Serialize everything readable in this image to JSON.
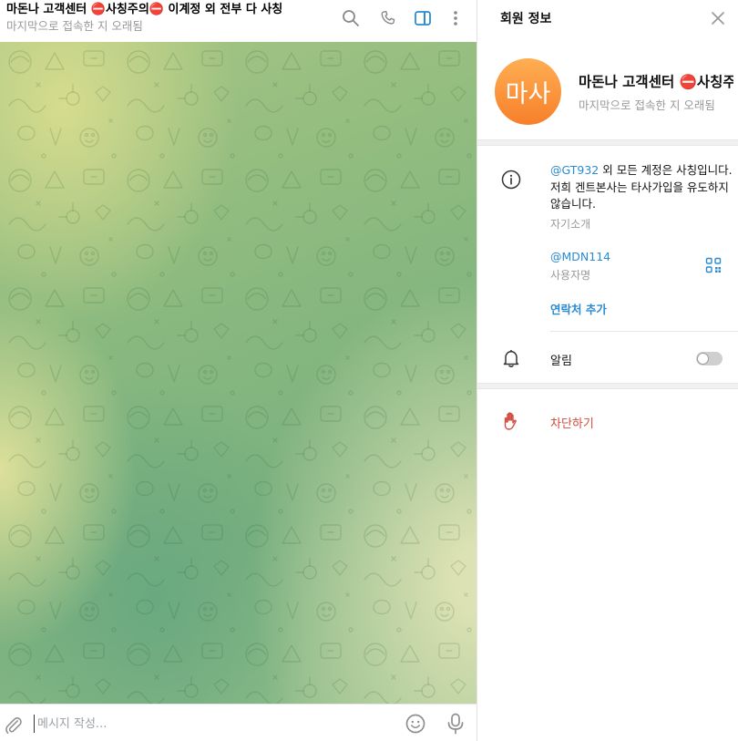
{
  "chat": {
    "title": "마돈나 고객센터 ⛔사칭주의⛔ 이계정 외 전부 다 사칭",
    "status": "마지막으로 접속한 지 오래됨",
    "header_icons": [
      "search-icon",
      "phone-icon",
      "sidebar-toggle-icon",
      "more-vertical-icon"
    ]
  },
  "composer": {
    "placeholder": "메시지 작성...",
    "icons": [
      "attach-icon",
      "emoji-icon",
      "microphone-icon"
    ]
  },
  "info_panel": {
    "title": "회원 정보",
    "avatar_initials": "마사",
    "name": "마돈나 고객센터 ⛔사칭주의⛔ 이계정 외 전부 다 사칭",
    "status": "마지막으로 접속한 지 오래됨",
    "bio_mention": "@GT932",
    "bio_text": " 외 모든 계정은 사칭입니다. 저희 겐트본사는 타사가입을 유도하지않습니다.",
    "bio_label": "자기소개",
    "username": "@MDN114",
    "username_label": "사용자명",
    "add_contact": "연락처 추가",
    "notifications_label": "알림",
    "notifications_enabled": false,
    "block_label": "차단하기"
  },
  "colors": {
    "accent": "#2a8bd1",
    "danger": "#d14a3d",
    "avatar_top": "#ffae53",
    "avatar_bottom": "#f77f2a"
  }
}
